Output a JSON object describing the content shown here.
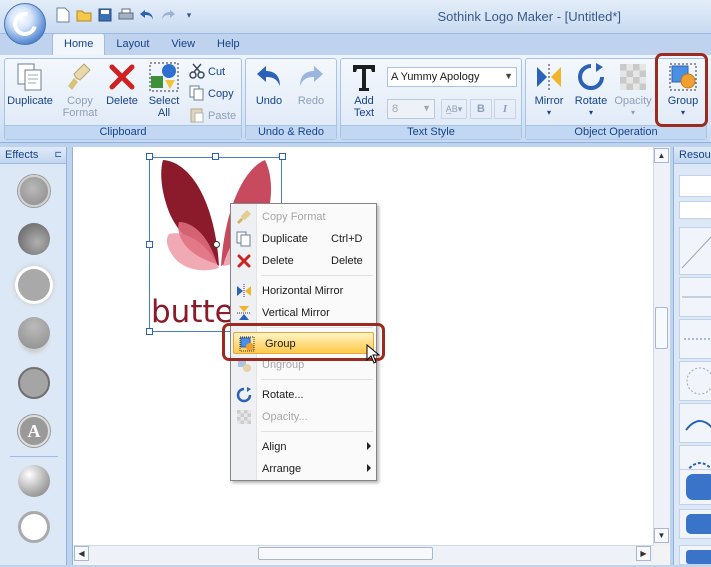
{
  "window": {
    "title": "Sothink Logo Maker - [Untitled*]"
  },
  "tabs": [
    {
      "label": "Home",
      "active": true
    },
    {
      "label": "Layout"
    },
    {
      "label": "View"
    },
    {
      "label": "Help"
    }
  ],
  "ribbon": {
    "clipboard": {
      "label": "Clipboard",
      "duplicate": "Duplicate",
      "copy_format_1": "Copy",
      "copy_format_2": "Format",
      "delete": "Delete",
      "select_all_1": "Select",
      "select_all_2": "All",
      "cut": "Cut",
      "copy": "Copy",
      "paste": "Paste"
    },
    "undo_redo": {
      "label": "Undo & Redo",
      "undo": "Undo",
      "redo": "Redo"
    },
    "text_style": {
      "label": "Text Style",
      "add_text_1": "Add",
      "add_text_2": "Text",
      "font_value": "A Yummy Apology",
      "size_value": "8",
      "bold": "B",
      "italic": "I"
    },
    "object_operation": {
      "label": "Object Operation",
      "mirror": "Mirror",
      "rotate": "Rotate",
      "opacity": "Opacity",
      "group": "Group"
    }
  },
  "effects_panel": {
    "title": "Effects",
    "text_effect_glyph": "A"
  },
  "resources_panel": {
    "title": "Resou"
  },
  "canvas": {
    "logo_text": "butte"
  },
  "context_menu": {
    "items": [
      {
        "label": "Copy Format",
        "shortcut": "",
        "disabled": true
      },
      {
        "label": "Duplicate",
        "shortcut": "Ctrl+D"
      },
      {
        "label": "Delete",
        "shortcut": "Delete"
      },
      {
        "label": "Horizontal Mirror",
        "shortcut": ""
      },
      {
        "label": "Vertical Mirror",
        "shortcut": ""
      },
      {
        "label": "Group",
        "shortcut": "",
        "hover": true
      },
      {
        "label": "Ungroup",
        "shortcut": "",
        "disabled": true
      },
      {
        "label": "Rotate...",
        "shortcut": ""
      },
      {
        "label": "Opacity...",
        "shortcut": "",
        "disabled": true
      },
      {
        "label": "Align",
        "shortcut": "",
        "submenu": true
      },
      {
        "label": "Arrange",
        "shortcut": "",
        "submenu": true
      }
    ]
  },
  "colors": {
    "highlight_border": "#9c2a1e",
    "logo_dark": "#8b1a2b",
    "logo_mid": "#c74a5e",
    "logo_light": "#f1a9b4",
    "ribbon_text": "#15428b"
  }
}
